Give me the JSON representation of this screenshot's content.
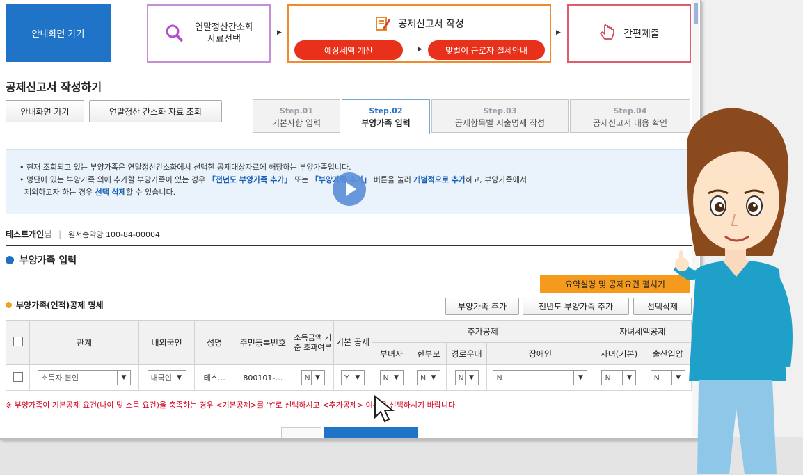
{
  "top": {
    "home_button": "안내화면 가기",
    "step1_label_line1": "연말정산간소화",
    "step1_label_line2": "자료선택",
    "step2_label": "공제신고서 작성",
    "step2_pill1": "예상세액 계산",
    "step2_pill2": "맞벌이 근로자 절세안내",
    "step3_label": "간편제출"
  },
  "page": {
    "title": "공제신고서 작성하기",
    "btn_home": "안내화면 가기",
    "btn_lookup": "연말정산 간소화 자료 조회"
  },
  "tabs": [
    {
      "step": "Step.01",
      "label": "기본사항 입력"
    },
    {
      "step": "Step.02",
      "label": "부양가족 입력"
    },
    {
      "step": "Step.03",
      "label": "공제항목별 지출명세 작성"
    },
    {
      "step": "Step.04",
      "label": "공제신고서 내용 확인"
    }
  ],
  "info": {
    "line1": "현재 조회되고 있는 부양가족은 연말정산간소화에서 선택한 공제대상자료에 해당하는 부양가족입니다.",
    "line2_a": "명단에 있는 부양가족 외에 추가할 부양가족이 있는 경우 ",
    "line2_b": "「전년도 부양가족 추가」",
    "line2_c": " 또는 ",
    "line2_d": "「부양가족 추가」",
    "line2_e": " 버튼을 눌러 ",
    "line2_f": "개별적으로 추가",
    "line2_g": "하고, 부양가족에서",
    "line3_a": "제외하고자 하는 경우 ",
    "line3_b": "선택 삭제",
    "line3_c": "할 수 있습니다."
  },
  "user": {
    "name": "테스트개인",
    "suffix": "님",
    "separator": "|",
    "company": "원서송약양 100-84-00004"
  },
  "section": {
    "title": "부양가족 입력",
    "orange_button": "요약설명 및 공제요건 펼치기",
    "subtitle": "부양가족(인적)공제 명세",
    "btn_add": "부양가족 추가",
    "btn_prev_year": "전년도 부양가족 추가",
    "btn_delete": "선택삭제"
  },
  "table": {
    "headers": {
      "relation": "관계",
      "nationality": "내외국인",
      "name": "성명",
      "rrn": "주민등록번호",
      "income": "소득금액 기준 초과여부",
      "basic": "기본 공제",
      "additional_group": "추가공제",
      "woman": "부녀자",
      "single_parent": "한부모",
      "elderly": "경로우대",
      "disabled": "장애인",
      "child_group": "자녀세액공제",
      "child": "자녀(기본)",
      "birth": "출산입양"
    },
    "row": {
      "relation": "소득자 본인",
      "nationality": "내국인",
      "name": "테스…",
      "rrn": "800101-…",
      "income": "N",
      "basic": "Y",
      "woman": "N",
      "single_parent": "N",
      "elderly": "N",
      "disabled": "N",
      "child": "N",
      "birth": "N"
    }
  },
  "note": "※ 부양가족이 기본공제 요건(나이 및 소득 요건)을 충족하는 경우 <기본공제>를 'Y'로 선택하시고 <추가공제> 여부를 선택하시기 바랍니다",
  "colors": {
    "primary_blue": "#1f74c7",
    "orange": "#f08a2b",
    "red_pill": "#e8301b",
    "note_red": "#d4001a"
  }
}
